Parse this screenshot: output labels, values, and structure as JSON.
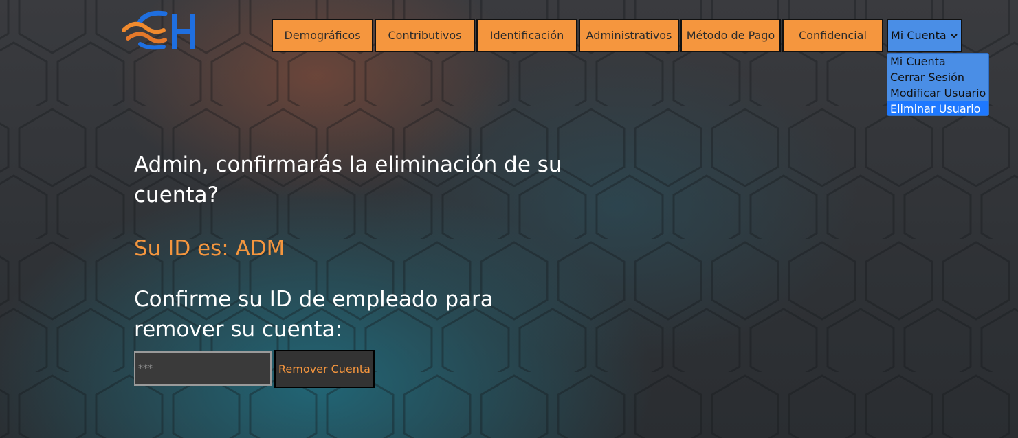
{
  "logo": {
    "text": "CH"
  },
  "nav": {
    "items": [
      {
        "label": "Demográficos"
      },
      {
        "label": "Contributivos"
      },
      {
        "label": "Identificación"
      },
      {
        "label": "Administrativos"
      },
      {
        "label": "Método de Pago"
      },
      {
        "label": "Confidencial"
      }
    ]
  },
  "account_menu": {
    "selected": "Mi Cuenta",
    "icon": "chevron-down-icon",
    "options": [
      {
        "label": "Mi Cuenta"
      },
      {
        "label": "Cerrar Sesión"
      },
      {
        "label": "Modificar Usuario"
      },
      {
        "label": "Eliminar Usuario"
      }
    ],
    "highlighted": "Eliminar Usuario"
  },
  "main": {
    "question": "Admin, confirmarás la eliminación de su cuenta?",
    "id_line": "Su ID es: ADM",
    "confirm_prompt": "Confirme su ID de empleado para remover su cuenta:",
    "input_placeholder": "***",
    "input_value": "",
    "remove_button": "Remover Cuenta"
  },
  "colors": {
    "accent_orange": "#f5963e",
    "menu_blue": "#4a8ee6",
    "selected_blue": "#1e78ff",
    "logo_blue": "#1f6fe0"
  }
}
